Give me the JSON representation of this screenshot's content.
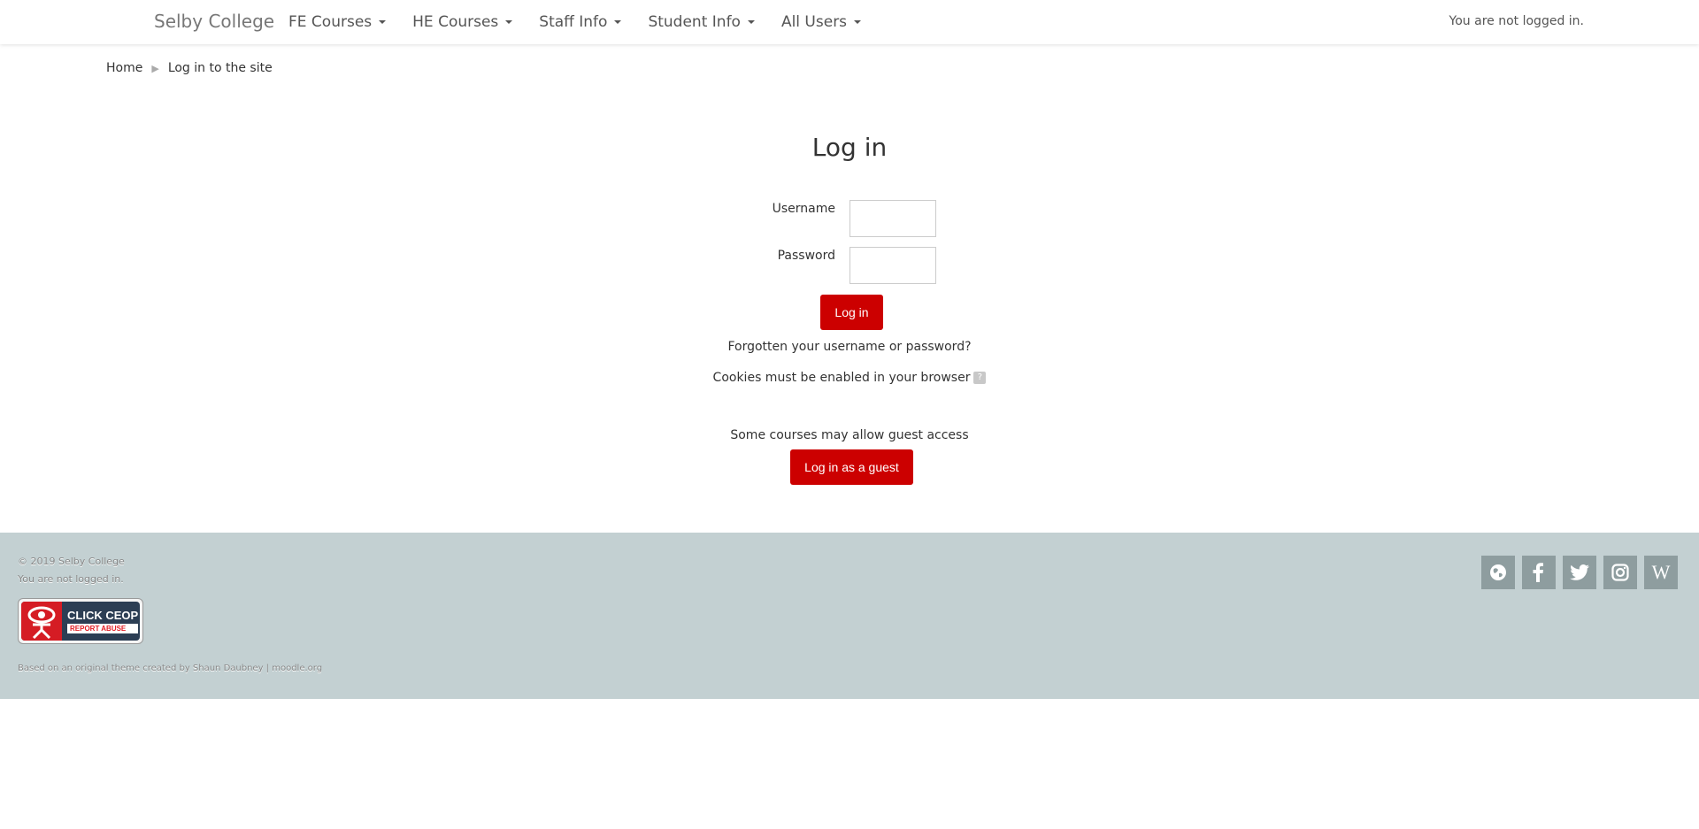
{
  "navbar": {
    "brand": "Selby College",
    "items": [
      {
        "label": "FE Courses"
      },
      {
        "label": "HE Courses"
      },
      {
        "label": "Staff Info"
      },
      {
        "label": "Student Info"
      },
      {
        "label": "All Users"
      }
    ],
    "login_status": "You are not logged in."
  },
  "breadcrumb": {
    "home": "Home",
    "current": "Log in to the site",
    "separator": "▶"
  },
  "login": {
    "title": "Log in",
    "username_label": "Username",
    "username_value": "",
    "password_label": "Password",
    "password_value": "",
    "login_button": "Log in",
    "forgot_link": "Forgotten your username or password?",
    "cookies_text": "Cookies must be enabled in your browser",
    "help_icon": "?",
    "guest_note": "Some courses may allow guest access",
    "guest_button": "Log in as a guest"
  },
  "footer": {
    "copyright": "© 2019 Selby College",
    "login_status": "You are not logged in.",
    "ceop_main": "CLICK CEOP",
    "ceop_sub": "REPORT ABUSE",
    "based_on": "Based on an original theme created by Shaun Daubney",
    "based_sep": " | ",
    "moodle_link": "moodle.org",
    "social": [
      {
        "icon": "globe-icon"
      },
      {
        "icon": "facebook-icon"
      },
      {
        "icon": "twitter-icon"
      },
      {
        "icon": "instagram-icon"
      },
      {
        "icon": "wikipedia-icon",
        "glyph": "W"
      }
    ]
  },
  "colors": {
    "accent_red": "#cc0000",
    "footer_bg": "#c3d0d2",
    "social_bg": "#8e9d9f"
  }
}
